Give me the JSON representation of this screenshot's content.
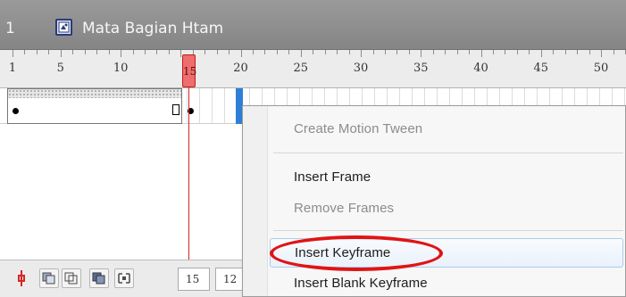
{
  "title_bar": {
    "scene_number": "1",
    "symbol_name": "Mata Bagian Htam",
    "symbol_icon": "movieclip-symbol-icon"
  },
  "ruler": {
    "labels": [
      "1",
      "5",
      "10",
      "15",
      "20",
      "25",
      "30",
      "35",
      "40",
      "45",
      "50"
    ]
  },
  "playhead": {
    "frame": "15"
  },
  "bottom_toolbar": {
    "icons": [
      "center-frame-icon",
      "onion-skin-icon",
      "onion-skin-outlines-icon",
      "edit-multiple-frames-icon",
      "modify-onion-markers-icon"
    ],
    "current_frame": "15",
    "frame_rate": "12"
  },
  "context_menu": {
    "items": [
      {
        "label": "Create Motion Tween",
        "enabled": false
      },
      {
        "label": "Insert Frame",
        "enabled": true
      },
      {
        "label": "Remove Frames",
        "enabled": false
      },
      {
        "label": "Insert Keyframe",
        "enabled": true,
        "hovered": true
      },
      {
        "label": "Insert Blank Keyframe",
        "enabled": true
      }
    ]
  },
  "colors": {
    "playhead": "#d52424",
    "highlight_ellipse": "#e01414",
    "menu_hover": "#aecbeb"
  }
}
